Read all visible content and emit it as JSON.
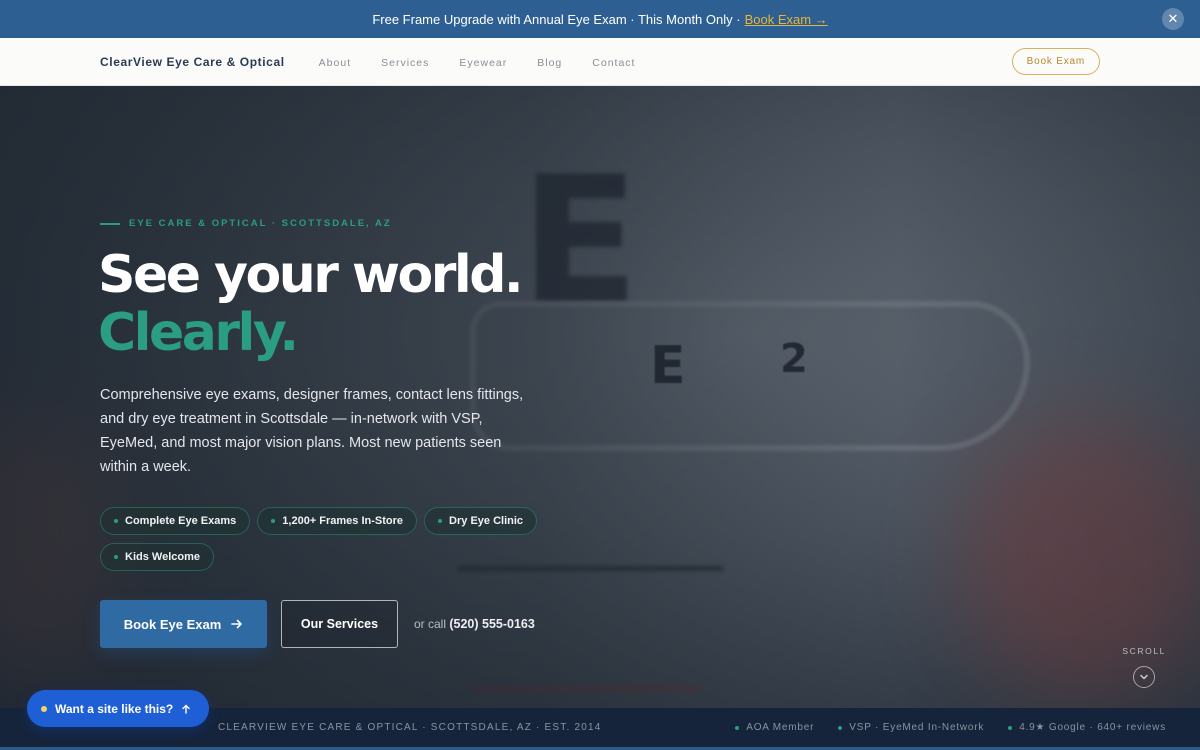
{
  "announcement": {
    "text": "Free Frame Upgrade with Annual Eye Exam · This Month Only ·",
    "link": "Book Exam →",
    "close_glyph": "✕"
  },
  "nav": {
    "brand": "ClearView Eye Care & Optical",
    "links": [
      "About",
      "Services",
      "Eyewear",
      "Blog",
      "Contact"
    ],
    "cta": "Book Exam"
  },
  "hero": {
    "eyebrow": "EYE CARE & OPTICAL · SCOTTSDALE, AZ",
    "headline_line1": "See your world.",
    "headline_line2": "Clearly.",
    "lede": "Comprehensive eye exams, designer frames, contact lens fittings, and dry eye treatment in Scottsdale — in-network with VSP, EyeMed, and most major vision plans. Most new patients seen within a week.",
    "chips": [
      "Complete Eye Exams",
      "1,200+ Frames In-Store",
      "Dry Eye Clinic",
      "Kids Welcome"
    ],
    "primary_cta": "Book Eye Exam",
    "primary_cta_icon": "arrow-right-icon",
    "secondary_cta": "Our Services",
    "call_prefix": "or call",
    "phone": "(520) 555-0163",
    "scroll_label": "SCROLL",
    "scroll_icon": "chevron-down-icon",
    "accent_color": "#2a9d82",
    "primary_color": "#2f6aa3"
  },
  "footer_strip": {
    "left": "CLEARVIEW EYE CARE & OPTICAL · SCOTTSDALE, AZ · EST. 2014",
    "badges": [
      "AOA Member",
      "VSP · EyeMed In-Network",
      "4.9★ Google · 640+ reviews"
    ]
  },
  "widget": {
    "label": "Want a site like this?",
    "icon": "arrow-up-icon"
  }
}
